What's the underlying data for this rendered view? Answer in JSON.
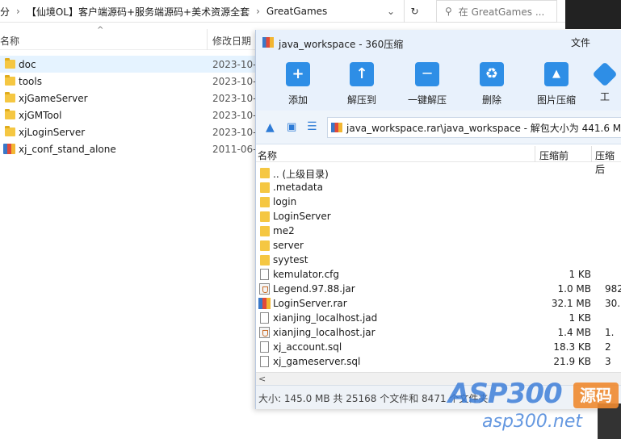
{
  "explorer": {
    "breadcrumb": [
      "分",
      "【仙境OL】客户端源码+服务端源码+美术资源全套",
      "GreatGames"
    ],
    "search_placeholder": "在 GreatGames ...",
    "columns": {
      "name": "名称",
      "date": "修改日期"
    },
    "rows": [
      {
        "name": "doc",
        "date": "2023-10-",
        "type": "folder"
      },
      {
        "name": "tools",
        "date": "2023-10-",
        "type": "folder"
      },
      {
        "name": "xjGameServer",
        "date": "2023-10-",
        "type": "folder"
      },
      {
        "name": "xjGMTool",
        "date": "2023-10-",
        "type": "folder"
      },
      {
        "name": "xjLoginServer",
        "date": "2023-10-",
        "type": "folder"
      },
      {
        "name": "xj_conf_stand_alone",
        "date": "2011-06-",
        "type": "archive"
      }
    ]
  },
  "zipwin": {
    "title": "java_workspace - 360压缩",
    "menu_file": "文件",
    "toolbar": [
      {
        "label": "添加",
        "icon": "add-icon"
      },
      {
        "label": "解压到",
        "icon": "extract-icon"
      },
      {
        "label": "一键解压",
        "icon": "one-click-extract-icon"
      },
      {
        "label": "删除",
        "icon": "delete-icon"
      },
      {
        "label": "图片压缩",
        "icon": "image-compress-icon"
      },
      {
        "label": "工",
        "icon": "tools-icon"
      }
    ],
    "path": "java_workspace.rar\\java_workspace - 解包大小为 441.6 MB",
    "columns": {
      "name": "名称",
      "size": "压缩前",
      "compressed": "压缩后"
    },
    "rows": [
      {
        "name": ".. (上级目录)",
        "size": "",
        "comp": "",
        "type": "folder"
      },
      {
        "name": ".metadata",
        "size": "",
        "comp": "",
        "type": "folder"
      },
      {
        "name": "login",
        "size": "",
        "comp": "",
        "type": "folder"
      },
      {
        "name": "LoginServer",
        "size": "",
        "comp": "",
        "type": "folder"
      },
      {
        "name": "me2",
        "size": "",
        "comp": "",
        "type": "folder"
      },
      {
        "name": "server",
        "size": "",
        "comp": "",
        "type": "folder"
      },
      {
        "name": "syytest",
        "size": "",
        "comp": "",
        "type": "folder"
      },
      {
        "name": "kemulator.cfg",
        "size": "1 KB",
        "comp": "",
        "type": "file"
      },
      {
        "name": "Legend.97.88.jar",
        "size": "1.0 MB",
        "comp": "982",
        "type": "jar"
      },
      {
        "name": "LoginServer.rar",
        "size": "32.1 MB",
        "comp": "30.",
        "type": "rar"
      },
      {
        "name": "xianjing_localhost.jad",
        "size": "1 KB",
        "comp": "",
        "type": "file"
      },
      {
        "name": "xianjing_localhost.jar",
        "size": "1.4 MB",
        "comp": "1.",
        "type": "jar"
      },
      {
        "name": "xj_account.sql",
        "size": "18.3 KB",
        "comp": "2",
        "type": "file"
      },
      {
        "name": "xj_gameserver.sql",
        "size": "21.9 KB",
        "comp": "3",
        "type": "file"
      }
    ],
    "status": "大小: 145.0 MB 共 25168 个文件和 8471 个文件夹"
  },
  "watermark": {
    "brand": "ASP300",
    "tag": "源码",
    "url": "asp300.net"
  }
}
